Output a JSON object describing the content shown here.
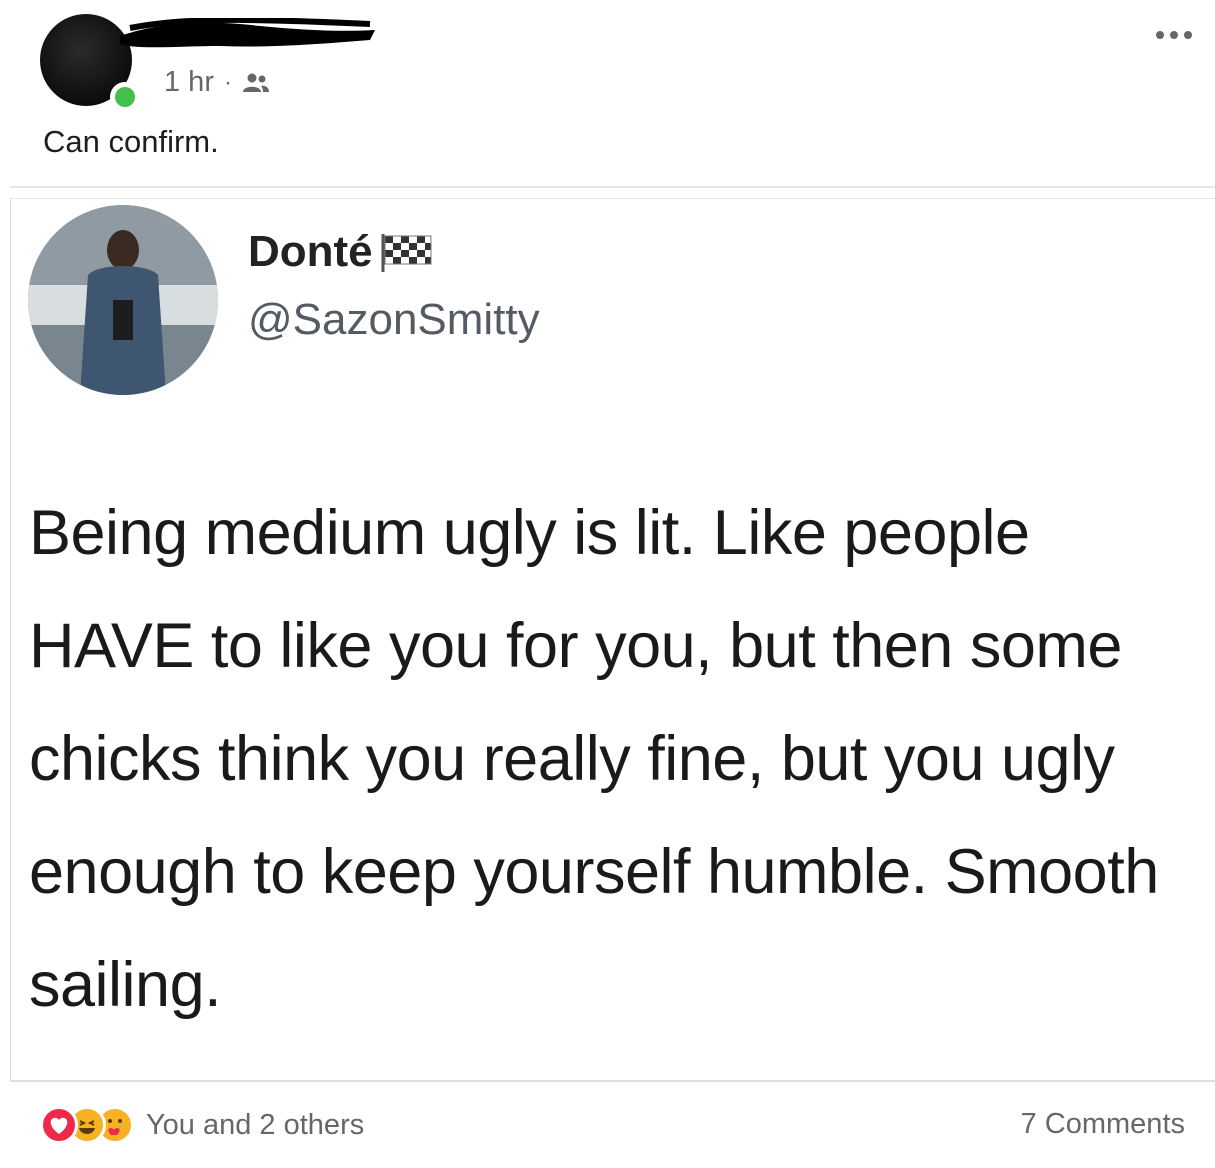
{
  "post": {
    "time": "1 hr",
    "separator": "·",
    "audience_icon": "friends-icon",
    "caption": "Can confirm.",
    "more_icon": "more-dots-icon"
  },
  "shared_tweet": {
    "display_name": "Donté",
    "name_emoji": "checkered-flag-icon",
    "handle": "@SazonSmitty",
    "body": "Being medium ugly is lit. Like people HAVE to like you for you, but then some chicks think you really fine, but you ugly enough to keep yourself humble. Smooth sailing."
  },
  "footer": {
    "reactions": [
      "love-icon",
      "haha-icon",
      "care-icon"
    ],
    "reactions_text": "You and 2 others",
    "comments": "7 Comments"
  },
  "colors": {
    "online": "#44c04a",
    "secondary_text": "#65676b",
    "love": "#f0284a",
    "haha": "#f7b125"
  }
}
